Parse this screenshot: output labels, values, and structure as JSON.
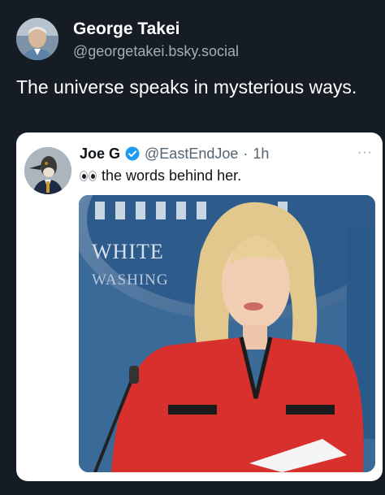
{
  "post": {
    "author_name": "George Takei",
    "author_handle": "@georgetakei.bsky.social",
    "text": "The universe speaks in mysterious ways."
  },
  "embed": {
    "name": "Joe G",
    "handle": "@EastEndJoe",
    "separator": "·",
    "time": "1h",
    "more": "···",
    "text": "the words behind her.",
    "icons": [
      "verified-icon",
      "eyes-icon",
      "more-icon"
    ],
    "image_sign_lines": [
      "WHITE",
      "WASHING"
    ],
    "colors": {
      "verified": "#1d9bf0",
      "background": "#161c24",
      "card": "#ffffff"
    }
  }
}
